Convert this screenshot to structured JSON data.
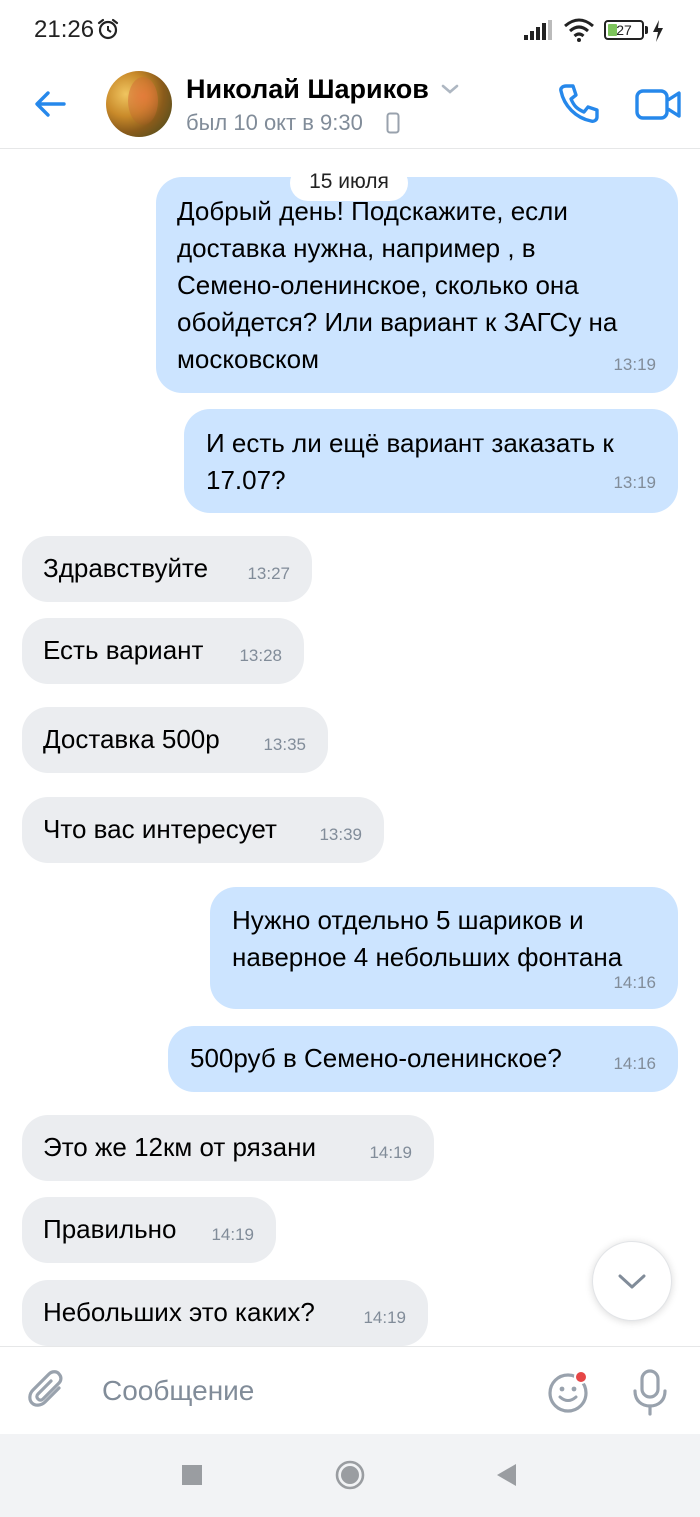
{
  "status_bar": {
    "time": "21:26",
    "battery": "27",
    "battery_level": 0.27
  },
  "header": {
    "contact_name": "Николай Шариков",
    "last_seen": "был 10 окт в 9:30"
  },
  "chat": {
    "date_label": "15 июля",
    "messages": [
      {
        "dir": "out",
        "lines": [
          "Добрый день! Подскажите, если",
          "доставка нужна, например , в",
          "Семено-оленинское, сколько она",
          "обойдется? Или вариант к ЗАГСу на",
          "московском"
        ],
        "time": "13:19"
      },
      {
        "dir": "out",
        "lines": [
          "И есть ли ещё вариант заказать к",
          "17.07?"
        ],
        "time": "13:19"
      },
      {
        "dir": "in",
        "lines": [
          "Здравствуйте"
        ],
        "time": "13:27"
      },
      {
        "dir": "in",
        "lines": [
          "Есть вариант"
        ],
        "time": "13:28"
      },
      {
        "dir": "in",
        "lines": [
          "Доставка 500р"
        ],
        "time": "13:35"
      },
      {
        "dir": "in",
        "lines": [
          "Что вас интересует"
        ],
        "time": "13:39"
      },
      {
        "dir": "out",
        "lines": [
          "Нужно отдельно 5 шариков и",
          "наверное 4 небольших фонтана"
        ],
        "time": "14:16"
      },
      {
        "dir": "out",
        "lines": [
          "500руб в Семено-оленинское?"
        ],
        "time": "14:16"
      },
      {
        "dir": "in",
        "lines": [
          "Это же 12км от рязани"
        ],
        "time": "14:19"
      },
      {
        "dir": "in",
        "lines": [
          "Правильно"
        ],
        "time": "14:19"
      },
      {
        "dir": "in",
        "lines": [
          "Небольших это каких?"
        ],
        "time": "14:19"
      }
    ]
  },
  "composer": {
    "placeholder": "Сообщение"
  },
  "colors": {
    "accent": "#2688eb",
    "outgoing_bubble": "#cce4ff",
    "incoming_bubble": "#ebedf0",
    "secondary_text": "#818c99",
    "unread_dot": "#e64646"
  },
  "icons": {
    "back": "arrow-left-icon",
    "call": "phone-icon",
    "video": "video-camera-icon",
    "attach": "paperclip-icon",
    "sticker": "smiley-icon",
    "voice": "microphone-icon",
    "scroll_down": "chevron-down-icon"
  }
}
